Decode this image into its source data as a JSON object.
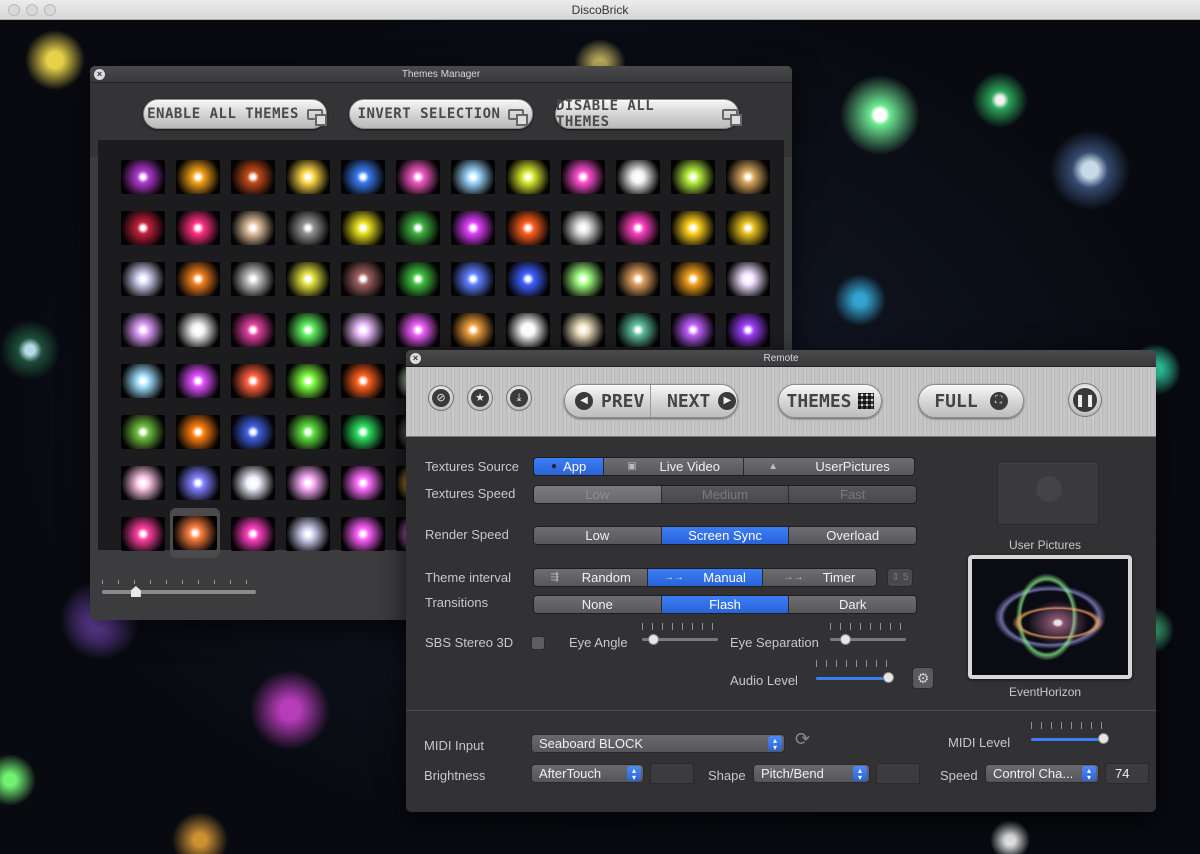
{
  "app": {
    "title": "DiscoBrick"
  },
  "themes_manager": {
    "title": "Themes Manager",
    "buttons": {
      "enable_all": "ENABLE ALL THEMES",
      "invert": "INVERT SELECTION",
      "disable_all": "DISABLE ALL THEMES"
    },
    "thumbnail_count": 96,
    "selected_index": 85,
    "zoom_level": 0.22,
    "thumb_colors": [
      "#b03ad0",
      "#f3a21b",
      "#c24a1a",
      "#ffd84a",
      "#3b7cf0",
      "#f05ac0",
      "#9fd8ff",
      "#d8e830",
      "#ff4fd0",
      "#f2f2f2",
      "#b8f040",
      "#d8a860",
      "#c0203c",
      "#ff3080",
      "#e0c0a0",
      "#909090",
      "#e8e020",
      "#40b040",
      "#e040ff",
      "#ff6020",
      "#e0e0e0",
      "#ff40c0",
      "#ffd020",
      "#e8c020",
      "#d0d0f0",
      "#f08020",
      "#c0c0c0",
      "#e0e040",
      "#a06060",
      "#40c040",
      "#6080ff",
      "#4060ff",
      "#a0ff80",
      "#e0a060",
      "#f0a020",
      "#f0e0ff",
      "#e0a0ff",
      "#f0f0f0",
      "#e040a0",
      "#60f060",
      "#f0c0ff",
      "#f060ff",
      "#f0a040",
      "#ffffff",
      "#f0e0c0",
      "#60c0a0",
      "#c060ff",
      "#a040ff",
      "#a0e0ff",
      "#e050ff",
      "#ff6040",
      "#80ff40",
      "#ff6020",
      "#e0ffe0",
      "#c0c0ff",
      "#c0ff80",
      "#f0e060",
      "#a0a0ff",
      "#ffb0e0",
      "#d0d0a0",
      "#70c040",
      "#ff8010",
      "#4060e0",
      "#60e040",
      "#30e060",
      "#808080",
      "#f0f0f0",
      "#f0f0f0",
      "#ffffff",
      "#ff80ff",
      "#e0e0e0",
      "#d0d0d0",
      "#ffc8e8",
      "#8080ff",
      "#f0f0ff",
      "#ffb0ff",
      "#ff70ff",
      "#ffb040",
      "#f0e0ff",
      "#ff80c0",
      "#f0f0f0",
      "#ffffff",
      "#f0f0f0",
      "#e0e0e0",
      "#ff40a0",
      "#ff8040",
      "#ff40c0",
      "#d0d0f0",
      "#ff60ff",
      "#f080ff",
      "#ffffff",
      "#e0e0e0",
      "#ffffff",
      "#ffffff",
      "#ffffff",
      "#ffffff"
    ]
  },
  "remote": {
    "title": "Remote",
    "toolbar": {
      "prev": "PREV",
      "next": "NEXT",
      "themes": "THEMES",
      "full": "FULL"
    },
    "textures_source": {
      "label": "Textures Source",
      "options": [
        "App",
        "Live Video",
        "UserPictures"
      ],
      "selected": 0
    },
    "textures_speed": {
      "label": "Textures Speed",
      "options": [
        "Low",
        "Medium",
        "Fast"
      ],
      "selected": 0
    },
    "render_speed": {
      "label": "Render Speed",
      "options": [
        "Low",
        "Screen Sync",
        "Overload"
      ],
      "selected": 1
    },
    "theme_interval": {
      "label": "Theme interval",
      "options": [
        "Random",
        "Manual",
        "Timer"
      ],
      "selected": 1,
      "timer_value": "5"
    },
    "transitions": {
      "label": "Transitions",
      "options": [
        "None",
        "Flash",
        "Dark"
      ],
      "selected": 1
    },
    "sbs": {
      "label": "SBS Stereo 3D",
      "eye_angle": "Eye Angle",
      "eye_separation": "Eye Separation"
    },
    "audio_level": {
      "label": "Audio Level",
      "value": 0.95
    },
    "eye_angle_value": 0.15,
    "eye_separation_value": 0.2,
    "user_pictures_label": "User Pictures",
    "current_theme": "EventHorizon",
    "midi": {
      "input_label": "MIDI Input",
      "input_value": "Seaboard BLOCK",
      "level_label": "MIDI Level",
      "level_value": 0.95,
      "brightness_label": "Brightness",
      "brightness_value": "AfterTouch",
      "shape_label": "Shape",
      "shape_value": "Pitch/Bend",
      "speed_label": "Speed",
      "speed_value": "Control Cha...",
      "speed_number": "74"
    }
  }
}
